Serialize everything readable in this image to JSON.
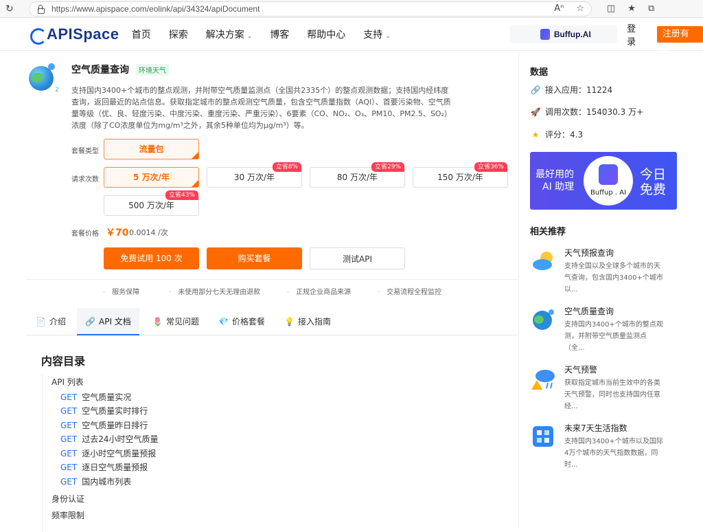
{
  "browser": {
    "url": "https://www.apispace.com/eolink/api/34324/apiDocument"
  },
  "header": {
    "logo_text": "APISpace",
    "nav": [
      {
        "label": "首页",
        "has_dropdown": false
      },
      {
        "label": "探索",
        "has_dropdown": false
      },
      {
        "label": "解决方案",
        "has_dropdown": true
      },
      {
        "label": "博客",
        "has_dropdown": false
      },
      {
        "label": "帮助中心",
        "has_dropdown": false
      },
      {
        "label": "支持",
        "has_dropdown": true
      }
    ],
    "promo": "Buffup.AI",
    "login": "登 录",
    "register": "注册有礼"
  },
  "product": {
    "title": "空气质量查询",
    "tag": "环境天气",
    "description": "支持国内3400+个城市的整点观测，并附带空气质量监测点（全国共2335个）的整点观测数据；支持国内经纬度查询，返回最近的站点信息。获取指定城市的整点观测空气质量，包含空气质量指数（AQI）、首要污染物、空气质量等级（优、良、轻度污染、中度污染、重度污染、严重污染）、6要素（CO、NO₂、O₃、PM10、PM2.5、SO₂）浓度（除了CO浓度单位为mg/m³之外，其余5种单位均为μg/m³）等。",
    "package_type_label": "套餐类型",
    "package_type": "流量包",
    "request_count_label": "请求次数",
    "request_options": [
      {
        "label": "5 万次/年",
        "badge": "",
        "selected": true
      },
      {
        "label": "30 万次/年",
        "badge": "立省8%",
        "selected": false
      },
      {
        "label": "80 万次/年",
        "badge": "立省29%",
        "selected": false
      },
      {
        "label": "150 万次/年",
        "badge": "立省36%",
        "selected": false
      },
      {
        "label": "500 万次/年",
        "badge": "立省43%",
        "selected": false
      }
    ],
    "price_label": "套餐价格",
    "price": "￥70",
    "unit_price": "0.0014 /次",
    "buttons": {
      "trial": "免费试用 100 次",
      "buy": "购买套餐",
      "test": "测试API"
    },
    "guarantees": [
      "服务保障",
      "未使用部分七天无理由退款",
      "正规企业商品来源",
      "交易流程全程监控"
    ]
  },
  "tabs": [
    {
      "label": "介绍",
      "icon": "document-icon",
      "active": false
    },
    {
      "label": "API 文档",
      "icon": "link-icon",
      "active": true
    },
    {
      "label": "常见问题",
      "icon": "flower-icon",
      "active": false
    },
    {
      "label": "价格套餐",
      "icon": "diamond-icon",
      "active": false
    },
    {
      "label": "接入指南",
      "icon": "bulb-icon",
      "active": false
    }
  ],
  "toc": {
    "title": "内容目录",
    "api_list_label": "API 列表",
    "items": [
      {
        "method": "GET",
        "name": "空气质量实况"
      },
      {
        "method": "GET",
        "name": "空气质量实时排行"
      },
      {
        "method": "GET",
        "name": "空气质量昨日排行"
      },
      {
        "method": "GET",
        "name": "过去24小时空气质量"
      },
      {
        "method": "GET",
        "name": "逐小时空气质量预报"
      },
      {
        "method": "GET",
        "name": "逐日空气质量预报"
      },
      {
        "method": "GET",
        "name": "国内城市列表"
      }
    ],
    "auth_label": "身份认证",
    "rate_limit_label": "频率限制"
  },
  "sidebar": {
    "stats_title": "数据",
    "stats": [
      {
        "icon": "link-icon",
        "text": "接入应用：11224"
      },
      {
        "icon": "rocket-icon",
        "text": "调用次数：154030.3 万+"
      },
      {
        "icon": "star-icon",
        "text": "评分：4.3"
      }
    ],
    "banner": {
      "line1": "最好用的",
      "line2": "AI 助理",
      "brand": "Buffup . AI",
      "right1": "今日",
      "right2": "免费",
      "bg_color": "#5b4de8"
    },
    "rec_title": "相关推荐",
    "recommendations": [
      {
        "name": "天气预报查询",
        "desc": "支持全国以及全球多个城市的天气查询，包含国内3400+个城市以...",
        "icon": "weather-cloud-icon"
      },
      {
        "name": "空气质量查询",
        "desc": "支持国内3400+个城市的整点观测，并附带空气质量监测点（全...",
        "icon": "air-quality-icon"
      },
      {
        "name": "天气预警",
        "desc": "获取指定城市当前生效中的各类天气预警，同时也支持国内任意经...",
        "icon": "weather-warning-icon"
      },
      {
        "name": "未来7天生活指数",
        "desc": "支持国内3400+个城市以及国际4万个城市的天气指数数据，同时...",
        "icon": "life-index-icon"
      }
    ]
  },
  "colors": {
    "accent": "#ff6a00",
    "link": "#2a6cf0",
    "badge": "#ff3d55"
  }
}
